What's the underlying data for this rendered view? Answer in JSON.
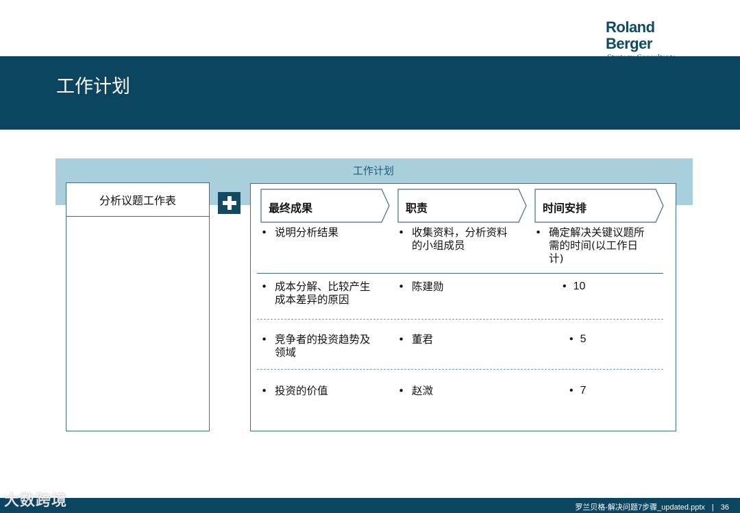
{
  "logo": {
    "main": "Roland Berger",
    "sub": "Strategy Consultants"
  },
  "title": "工作计划",
  "plan_title": "工作计划",
  "left_header": "分析议题工作表",
  "icons": {
    "plus": "plus-icon"
  },
  "columns": [
    {
      "label": "最终成果",
      "desc": "说明分析结果"
    },
    {
      "label": "职责",
      "desc_lines": [
        "收集资料，分析资料",
        "的小组成员"
      ]
    },
    {
      "label": "时间安排",
      "desc_lines": [
        "确定解决关键议题所",
        "需的时间(以工作日",
        "计)"
      ]
    }
  ],
  "rows": [
    {
      "result_lines": [
        "成本分解、比较产生",
        "成本差异的原因"
      ],
      "owner": "陈建勋",
      "time": "10"
    },
    {
      "result_lines": [
        "竞争者的投资趋势及",
        "领域"
      ],
      "owner": "董君",
      "time": "5"
    },
    {
      "result_lines": [
        "投资的价值"
      ],
      "owner": "赵溦",
      "time": "7"
    }
  ],
  "bullet": "•",
  "footer": {
    "file": "罗兰贝格-解决问题7步骤_updated.pptx",
    "separator": "|",
    "page": "36"
  },
  "watermark": "大数跨境",
  "colors": {
    "band": "#0b4560",
    "light_band": "#a9cfdc",
    "border": "#3d6f88"
  }
}
